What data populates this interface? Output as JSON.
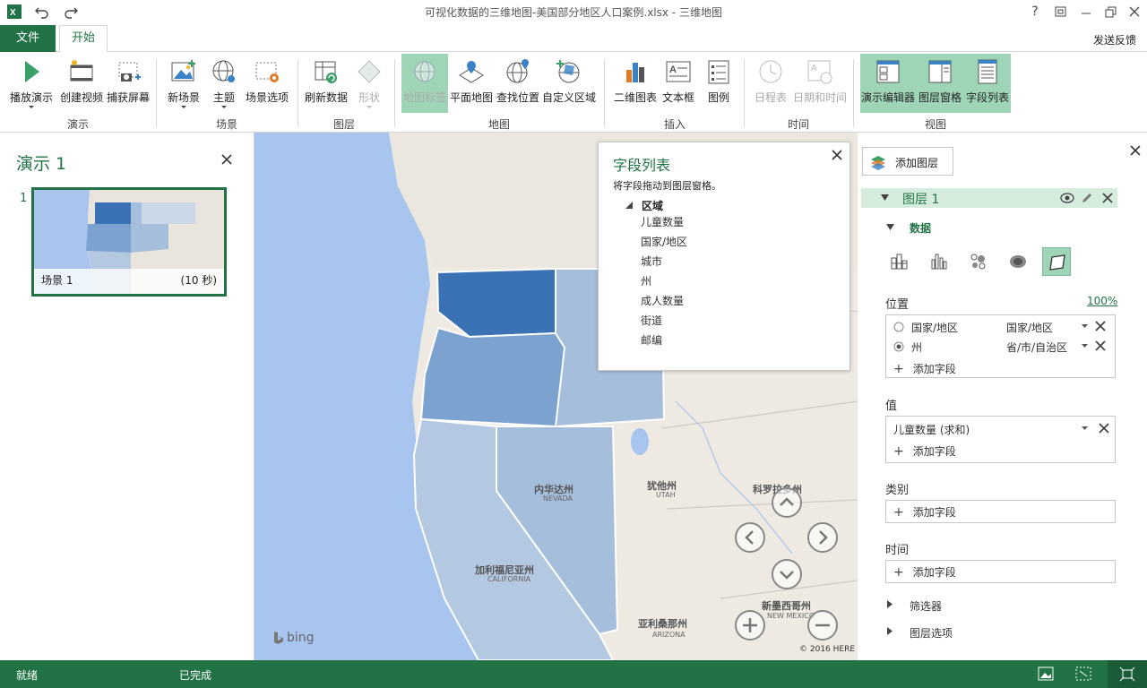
{
  "window": {
    "title": "可视化数据的三维地图-美国部分地区人口案例.xlsx - 三维地图",
    "app_icon": "excel-icon",
    "help": "?",
    "buttons": [
      "help-icon",
      "restore-icon",
      "minimize-icon",
      "maximize-icon",
      "close-icon"
    ]
  },
  "tabs": {
    "file": "文件",
    "home": "开始",
    "feedback": "发送反馈"
  },
  "ribbon": {
    "demo": {
      "play": "播放演示",
      "video": "创建视频",
      "capture": "捕获屏幕",
      "group": "演示"
    },
    "scene": {
      "new": "新场景",
      "theme": "主题",
      "options": "场景选项",
      "group": "场景"
    },
    "layer": {
      "refresh": "刷新数据",
      "shape": "形状",
      "group": "图层"
    },
    "map": {
      "labels": "地图标签",
      "flat": "平面地图",
      "find": "查找位置",
      "custom": "自定义区域",
      "group": "地图"
    },
    "insert": {
      "chart2d": "二维图表",
      "textbox": "文本框",
      "legend": "图例",
      "group": "插入"
    },
    "time": {
      "timeline": "日程表",
      "datetime": "日期和时间",
      "group": "时间"
    },
    "view": {
      "tour": "演示编辑器",
      "layerpane": "图层窗格",
      "fieldlist": "字段列表",
      "group": "视图"
    }
  },
  "tour": {
    "title": "演示 1",
    "number": "1",
    "scene_label": "场景 1",
    "scene_duration": "(10 秒)"
  },
  "map": {
    "labels": {
      "nevada_cn": "内华达州",
      "nevada_en": "NEVADA",
      "utah_cn": "犹他州",
      "utah_en": "UTAH",
      "california_cn": "加利福尼亚州",
      "california_en": "CALIFORNIA",
      "colorado_cn": "科罗拉多州",
      "newmexico_cn": "新墨西哥州",
      "newmexico_en": "NEW MEXICO",
      "arizona_cn": "亚利桑那州",
      "arizona_en": "ARIZONA"
    },
    "attribution": "© 2016 HERE",
    "bing": "bing"
  },
  "fieldlist": {
    "title": "字段列表",
    "hint": "将字段拖动到图层窗格。",
    "group": "区域",
    "fields": [
      "儿童数量",
      "国家/地区",
      "城市",
      "州",
      "成人数量",
      "街道",
      "邮编"
    ]
  },
  "layers": {
    "add_layer": "添加图层",
    "layer_name": "图层 1",
    "data_label": "数据",
    "position_label": "位置",
    "position_pct": "100%",
    "position_rows": [
      {
        "field": "国家/地区",
        "type": "国家/地区"
      },
      {
        "field": "州",
        "type": "省/市/自治区"
      }
    ],
    "add_field": "添加字段",
    "value_label": "值",
    "value_field": "儿童数量 (求和)",
    "category_label": "类别",
    "time_label": "时间",
    "filter_label": "筛选器",
    "options_label": "图层选项"
  },
  "status": {
    "ready": "就绪",
    "done": "已完成"
  },
  "colors": {
    "accent": "#217346",
    "selected": "#9fd5b7",
    "water": "#a8c5ef",
    "land": "#eeeae2"
  }
}
